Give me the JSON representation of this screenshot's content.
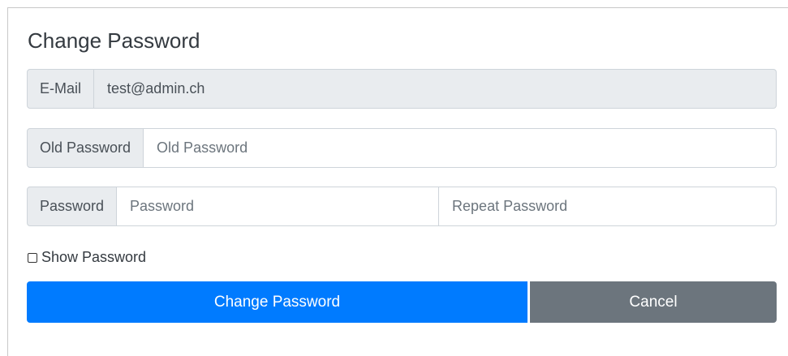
{
  "form": {
    "title": "Change Password",
    "email": {
      "label": "E-Mail",
      "value": "test@admin.ch"
    },
    "old_password": {
      "label": "Old Password",
      "placeholder": "Old Password",
      "value": ""
    },
    "password": {
      "label": "Password",
      "placeholder": "Password",
      "repeat_placeholder": "Repeat Password",
      "value": "",
      "repeat_value": ""
    },
    "show_password": {
      "label": "Show Password",
      "checked": false
    },
    "buttons": {
      "submit_label": "Change Password",
      "cancel_label": "Cancel"
    }
  },
  "colors": {
    "primary": "#007bff",
    "secondary": "#6c757d",
    "addon_bg": "#e9ecef",
    "border": "#ced4da"
  }
}
